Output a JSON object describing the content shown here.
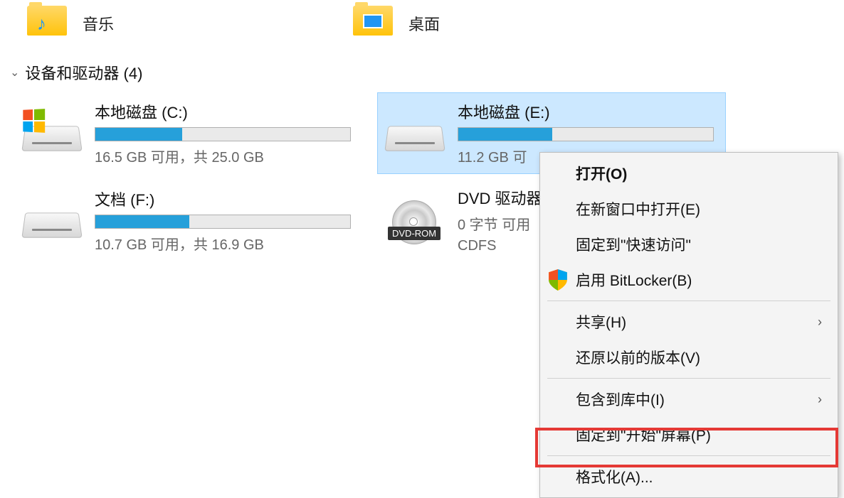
{
  "folders": {
    "music": "音乐",
    "desktop": "桌面"
  },
  "section": {
    "title": "设备和驱动器 (4)"
  },
  "drives": {
    "c": {
      "name": "本地磁盘 (C:)",
      "stats": "16.5 GB 可用，共 25.0 GB",
      "fill_percent": 34
    },
    "e": {
      "name": "本地磁盘 (E:)",
      "stats": "11.2 GB 可",
      "fill_percent": 37
    },
    "f": {
      "name": "文档 (F:)",
      "stats": "10.7 GB 可用，共 16.9 GB",
      "fill_percent": 37
    },
    "dvd": {
      "name": "DVD 驱动器",
      "stats": "0 字节 可用",
      "fs": "CDFS",
      "badge": "DVD-ROM"
    }
  },
  "menu": {
    "open": "打开(O)",
    "open_new_window": "在新窗口中打开(E)",
    "pin_quick_access": "固定到\"快速访问\"",
    "bitlocker": "启用 BitLocker(B)",
    "share": "共享(H)",
    "restore_prev": "还原以前的版本(V)",
    "include_library": "包含到库中(I)",
    "pin_start": "固定到\"开始\"屏幕(P)",
    "format": "格式化(A)..."
  }
}
